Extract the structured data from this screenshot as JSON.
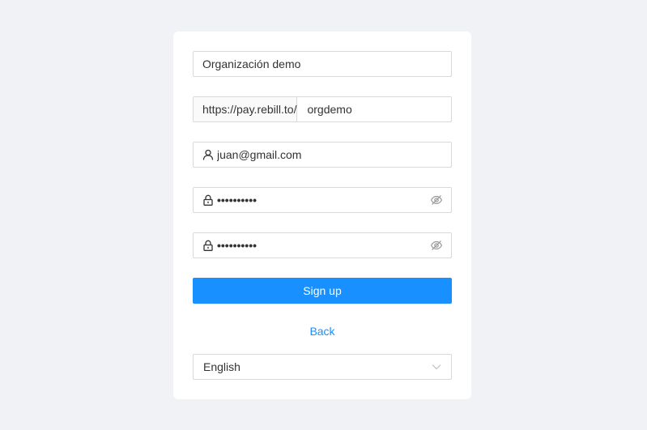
{
  "form": {
    "organization": {
      "value": "Organización demo"
    },
    "url": {
      "prefix": "https://pay.rebill.to/",
      "value": "orgdemo"
    },
    "email": {
      "value": "juan@gmail.com",
      "icon": "user-icon"
    },
    "password": {
      "value": "••••••••••",
      "icon": "lock-icon",
      "toggle_icon": "eye-invisible-icon"
    },
    "confirm_password": {
      "value": "••••••••••",
      "icon": "lock-icon",
      "toggle_icon": "eye-invisible-icon"
    },
    "signup_label": "Sign up",
    "back_label": "Back",
    "language": {
      "selected": "English",
      "icon": "chevron-down-icon"
    }
  },
  "colors": {
    "background": "#f0f2f5",
    "card": "#ffffff",
    "primary": "#1890ff",
    "border": "#d9d9d9"
  }
}
